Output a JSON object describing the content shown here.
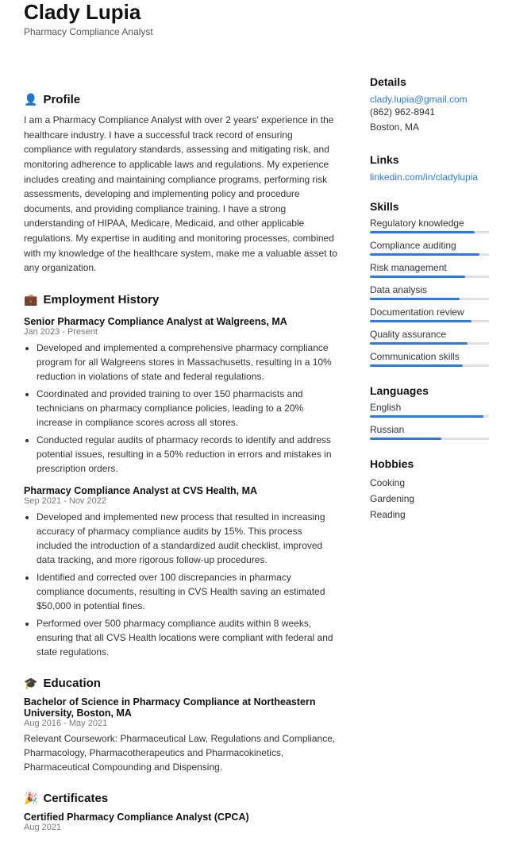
{
  "header": {
    "name": "Clady Lupia",
    "subtitle": "Pharmacy Compliance Analyst"
  },
  "sections": {
    "profile": {
      "title": "Profile",
      "icon": "👤",
      "text": "I am a Pharmacy Compliance Analyst with over 2 years' experience in the healthcare industry. I have a successful track record of ensuring compliance with regulatory standards, assessing and mitigating risk, and monitoring adherence to applicable laws and regulations. My experience includes creating and maintaining compliance programs, performing risk assessments, developing and implementing policy and procedure documents, and providing compliance training. I have a strong understanding of HIPAA, Medicare, Medicaid, and other applicable regulations. My expertise in auditing and monitoring processes, combined with my knowledge of the healthcare system, make me a valuable asset to any organization."
    },
    "employment": {
      "title": "Employment History",
      "icon": "💼",
      "jobs": [
        {
          "title": "Senior Pharmacy Compliance Analyst at Walgreens, MA",
          "date": "Jan 2023 - Present",
          "bullets": [
            "Developed and implemented a comprehensive pharmacy compliance program for all Walgreens stores in Massachusetts, resulting in a 10% reduction in violations of state and federal regulations.",
            "Coordinated and provided training to over 150 pharmacists and technicians on pharmacy compliance policies, leading to a 20% increase in compliance scores across all stores.",
            "Conducted regular audits of pharmacy records to identify and address potential issues, resulting in a 50% reduction in errors and mistakes in prescription orders."
          ]
        },
        {
          "title": "Pharmacy Compliance Analyst at CVS Health, MA",
          "date": "Sep 2021 - Nov 2022",
          "bullets": [
            "Developed and implemented new process that resulted in increasing accuracy of pharmacy compliance audits by 15%. This process included the introduction of a standardized audit checklist, improved data tracking, and more rigorous follow-up procedures.",
            "Identified and corrected over 100 discrepancies in pharmacy compliance documents, resulting in CVS Health saving an estimated $50,000 in potential fines.",
            "Performed over 500 pharmacy compliance audits within 8 weeks, ensuring that all CVS Health locations were compliant with federal and state regulations."
          ]
        }
      ]
    },
    "education": {
      "title": "Education",
      "icon": "🎓",
      "entries": [
        {
          "degree": "Bachelor of Science in Pharmacy Compliance at Northeastern University, Boston, MA",
          "date": "Aug 2016 - May 2021",
          "text": "Relevant Coursework: Pharmaceutical Law, Regulations and Compliance, Pharmacology, Pharmacotherapeutics and Pharmacokinetics, Pharmaceutical Compounding and Dispensing."
        }
      ]
    },
    "certificates": {
      "title": "Certificates",
      "icon": "🏅",
      "entries": [
        {
          "name": "Certified Pharmacy Compliance Analyst (CPCA)",
          "date": "Aug 2021"
        }
      ]
    }
  },
  "sidebar": {
    "details": {
      "title": "Details",
      "email": "clady.lupia@gmail.com",
      "phone": "(862) 962-8941",
      "location": "Boston, MA"
    },
    "links": {
      "title": "Links",
      "url": "linkedin.com/in/cladylupia"
    },
    "skills": {
      "title": "Skills",
      "items": [
        {
          "label": "Regulatory knowledge",
          "percent": 88
        },
        {
          "label": "Compliance auditing",
          "percent": 92
        },
        {
          "label": "Risk management",
          "percent": 80
        },
        {
          "label": "Data analysis",
          "percent": 75
        },
        {
          "label": "Documentation review",
          "percent": 85
        },
        {
          "label": "Quality assurance",
          "percent": 82
        },
        {
          "label": "Communication skills",
          "percent": 78
        }
      ]
    },
    "languages": {
      "title": "Languages",
      "items": [
        {
          "label": "English",
          "percent": 95
        },
        {
          "label": "Russian",
          "percent": 60
        }
      ]
    },
    "hobbies": {
      "title": "Hobbies",
      "items": [
        "Cooking",
        "Gardening",
        "Reading"
      ]
    }
  }
}
